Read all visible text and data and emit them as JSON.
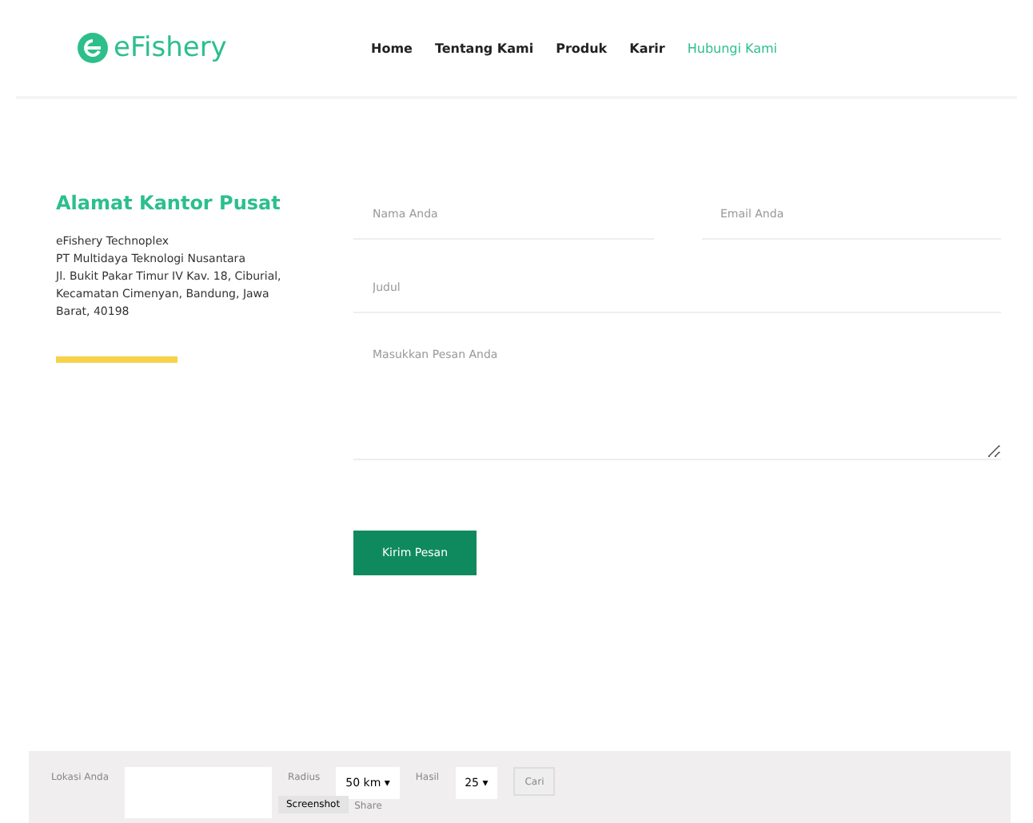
{
  "header": {
    "logo": "eFishery",
    "nav": [
      {
        "label": "Home",
        "selected": false
      },
      {
        "label": "Tentang Kami",
        "selected": false
      },
      {
        "label": "Produk",
        "selected": false
      },
      {
        "label": "Karir",
        "selected": false
      },
      {
        "label": "Hubungi Kami",
        "selected": true
      }
    ]
  },
  "address": {
    "title": "Alamat Kantor Pusat",
    "lines": [
      "eFishery Technoplex",
      "PT Multidaya Teknologi Nusantara",
      "Jl. Bukit Pakar Timur IV Kav. 18, Ciburial,",
      "Kecamatan Cimenyan, Bandung, Jawa",
      "Barat, 40198"
    ]
  },
  "form": {
    "name": {
      "placeholder": "Nama Anda"
    },
    "email": {
      "placeholder": "Email Anda"
    },
    "subject": {
      "placeholder": "Judul"
    },
    "message": {
      "placeholder": "Masukkan Pesan Anda"
    },
    "submit": "Kirim Pesan"
  },
  "bottom_bar": {
    "location_label": "Lokasi Anda",
    "radius_label": "Radius",
    "radius": "50 km ▾",
    "results_label": "Hasil",
    "results": "25 ▾",
    "search": "Cari",
    "screenshot": "Screenshot",
    "share": "Share"
  }
}
